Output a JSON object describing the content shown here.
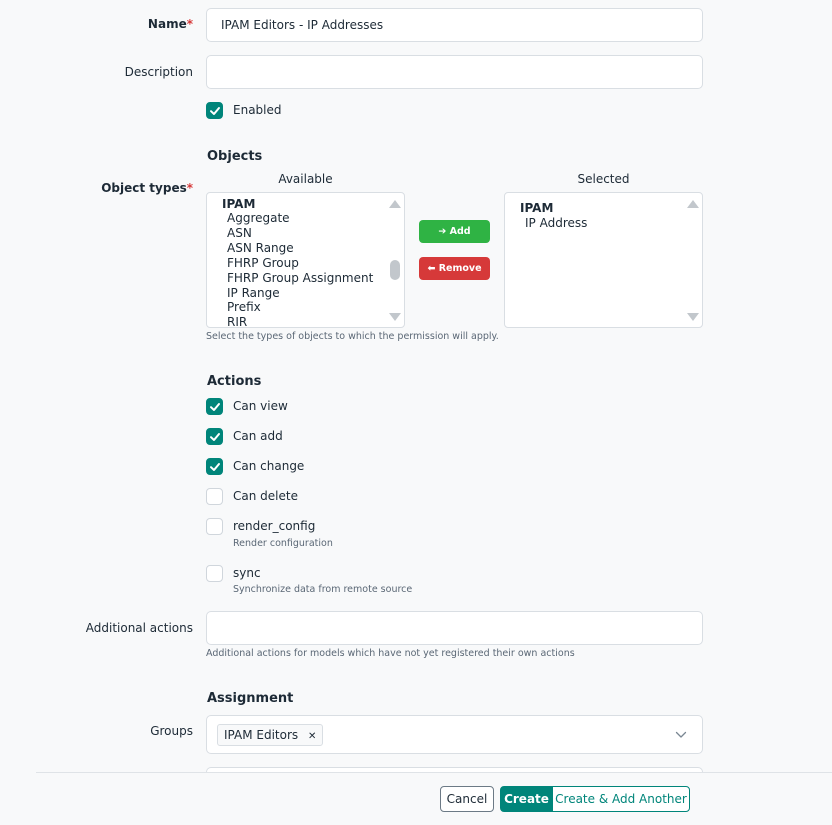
{
  "name": {
    "label": "Name",
    "value": "IPAM Editors - IP Addresses"
  },
  "description": {
    "label": "Description",
    "value": ""
  },
  "enabled": {
    "label": "Enabled",
    "checked": true
  },
  "objects": {
    "heading": "Objects",
    "label": "Object types",
    "available_header": "Available",
    "selected_header": "Selected",
    "available": {
      "group": "IPAM",
      "options": [
        "Aggregate",
        "ASN",
        "ASN Range",
        "FHRP Group",
        "FHRP Group Assignment",
        "IP Range",
        "Prefix",
        "RIR"
      ]
    },
    "selected": {
      "group": "IPAM",
      "options": [
        "IP Address"
      ]
    },
    "add_label": "Add",
    "remove_label": "Remove",
    "help": "Select the types of objects to which the permission will apply."
  },
  "actions": {
    "heading": "Actions",
    "items": [
      {
        "label": "Can view",
        "checked": true,
        "help": ""
      },
      {
        "label": "Can add",
        "checked": true,
        "help": ""
      },
      {
        "label": "Can change",
        "checked": true,
        "help": ""
      },
      {
        "label": "Can delete",
        "checked": false,
        "help": ""
      },
      {
        "label": "render_config",
        "checked": false,
        "help": "Render configuration"
      },
      {
        "label": "sync",
        "checked": false,
        "help": "Synchronize data from remote source"
      }
    ],
    "additional_label": "Additional actions",
    "additional_value": "",
    "additional_help": "Additional actions for models which have not yet registered their own actions"
  },
  "assignment": {
    "heading": "Assignment",
    "groups_label": "Groups",
    "groups": [
      "IPAM Editors"
    ]
  },
  "footer": {
    "cancel": "Cancel",
    "create": "Create",
    "create_another": "Create & Add Another"
  },
  "colors": {
    "primary": "#00857a",
    "add": "#2fb344",
    "remove": "#d63939"
  }
}
